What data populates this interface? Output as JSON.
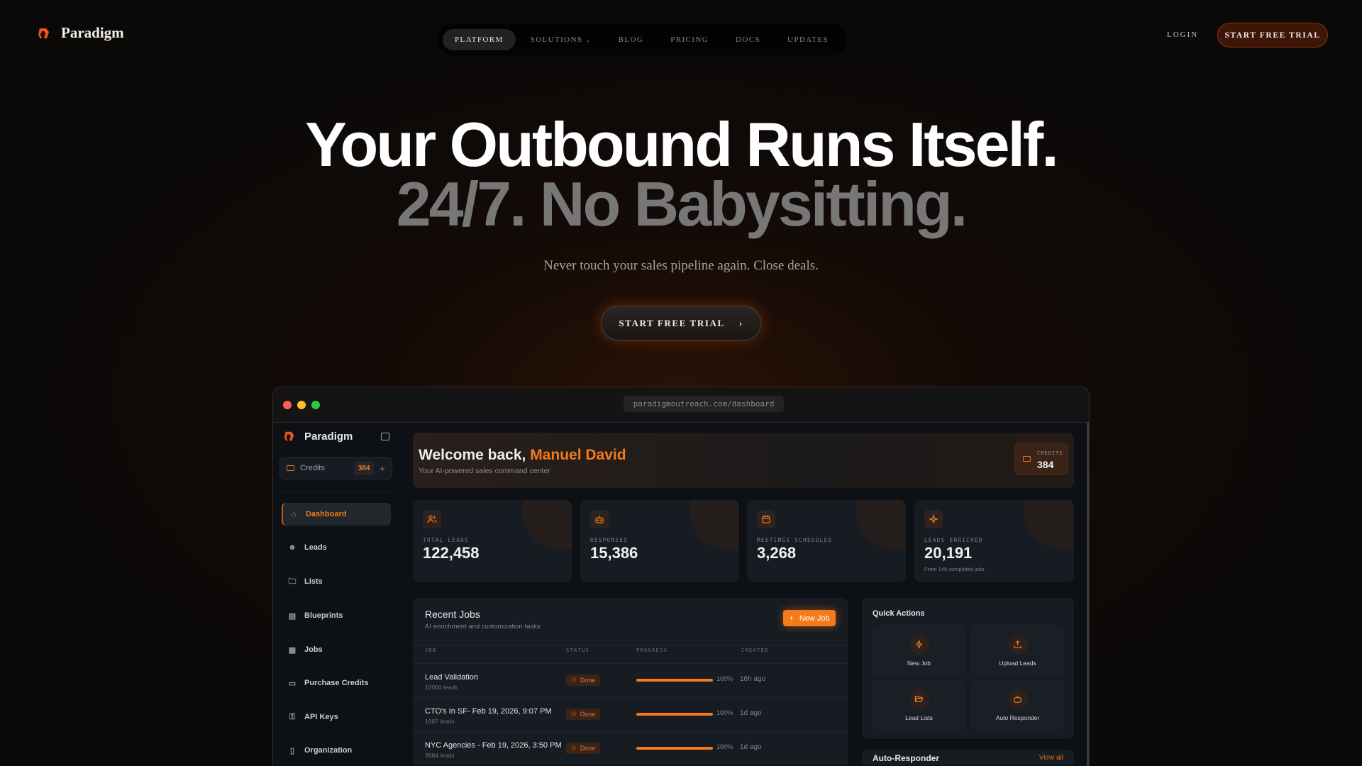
{
  "brand": {
    "name": "Paradigm",
    "accent": "#f47a1a"
  },
  "nav": {
    "items": [
      {
        "label": "PLATFORM",
        "active": true
      },
      {
        "label": "SOLUTIONS",
        "dropdown": true
      },
      {
        "label": "BLOG"
      },
      {
        "label": "PRICING"
      },
      {
        "label": "DOCS"
      },
      {
        "label": "UPDATES"
      }
    ],
    "login": "LOGIN",
    "trial": "START FREE TRIAL"
  },
  "hero": {
    "line1": "Your Outbound Runs Itself.",
    "line2": "24/7. No Babysitting.",
    "subtitle": "Never touch your sales pipeline again. Close deals.",
    "cta": "START FREE TRIAL"
  },
  "browser": {
    "url": "paradigmoutreach.com/dashboard"
  },
  "app": {
    "sidebar": {
      "brand": "Paradigm",
      "credits_label": "Credits",
      "credits_value": "384",
      "items": [
        {
          "label": "Dashboard",
          "icon": "home-icon",
          "active": true
        },
        {
          "label": "Leads",
          "icon": "users-icon"
        },
        {
          "label": "Lists",
          "icon": "folder-icon"
        },
        {
          "label": "Blueprints",
          "icon": "file-icon"
        },
        {
          "label": "Jobs",
          "icon": "building-icon"
        },
        {
          "label": "Purchase Credits",
          "icon": "credit-card-icon"
        },
        {
          "label": "API Keys",
          "icon": "key-icon"
        },
        {
          "label": "Organization",
          "icon": "organization-icon"
        }
      ]
    },
    "welcome": {
      "prefix": "Welcome back, ",
      "name": "Manuel David",
      "subtitle": "Your AI-powered sales command center",
      "credits_label": "CREDITS",
      "credits_value": "384"
    },
    "stats": [
      {
        "label": "TOTAL LEADS",
        "value": "122,458",
        "icon": "users-icon"
      },
      {
        "label": "RESPONSES",
        "value": "15,386",
        "icon": "bot-icon"
      },
      {
        "label": "MEETINGS SCHEDULED",
        "value": "3,268",
        "icon": "calendar-icon"
      },
      {
        "label": "LEADS ENRICHED",
        "value": "20,191",
        "note": "From 149 completed jobs",
        "icon": "sparkles-icon"
      }
    ],
    "jobs": {
      "title": "Recent Jobs",
      "subtitle": "AI enrichment and customization tasks",
      "new_button": "New Job",
      "columns": [
        "JOB",
        "STATUS",
        "PROGRESS",
        "CREATED"
      ],
      "rows": [
        {
          "name": "Lead Validation",
          "leads": "10000 leads",
          "status": "Done",
          "progress": 100,
          "progress_label": "100%",
          "created": "16h ago"
        },
        {
          "name": "CTO's In SF- Feb 19, 2026, 9:07 PM",
          "leads": "1687 leads",
          "status": "Done",
          "progress": 100,
          "progress_label": "100%",
          "created": "1d ago"
        },
        {
          "name": "NYC Agencies - Feb 19, 2026, 3:50 PM",
          "leads": "3984 leads",
          "status": "Done",
          "progress": 100,
          "progress_label": "100%",
          "created": "1d ago"
        }
      ]
    },
    "quick_actions": {
      "title": "Quick Actions",
      "items": [
        {
          "label": "New Job",
          "icon": "lightning-icon"
        },
        {
          "label": "Upload Leads",
          "icon": "upload-icon"
        },
        {
          "label": "Lead Lists",
          "icon": "folder-open-icon"
        },
        {
          "label": "Auto Responder",
          "icon": "bot-icon"
        }
      ]
    },
    "auto_responder": {
      "title": "Auto-Responder",
      "link": "View all"
    }
  }
}
